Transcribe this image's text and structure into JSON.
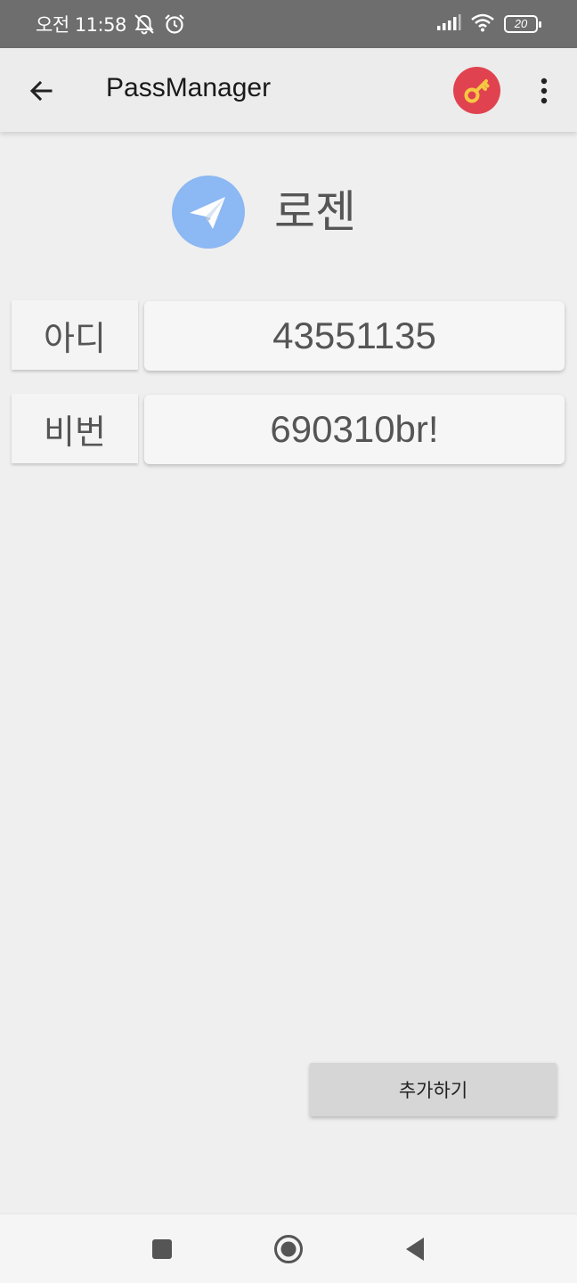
{
  "status_bar": {
    "time": "오전 11:58",
    "battery": "20",
    "icons": [
      "mute-icon",
      "alarm-icon",
      "signal-icon",
      "wifi-icon",
      "battery-icon"
    ]
  },
  "app_bar": {
    "title": "PassManager",
    "back_icon": "arrow-back-icon",
    "key_icon": "key-icon",
    "more_icon": "more-vert-icon",
    "key_button_color": "#e0434f"
  },
  "entry": {
    "name": "로젠",
    "icon": "paper-plane-icon",
    "icon_color": "#8cb8f3"
  },
  "fields": [
    {
      "label": "아디",
      "value": "43551135"
    },
    {
      "label": "비번",
      "value": "690310br!"
    }
  ],
  "add_button": {
    "label": "추가하기"
  },
  "nav_bar": {
    "icons": [
      "recent-apps-icon",
      "home-icon",
      "back-icon"
    ]
  }
}
